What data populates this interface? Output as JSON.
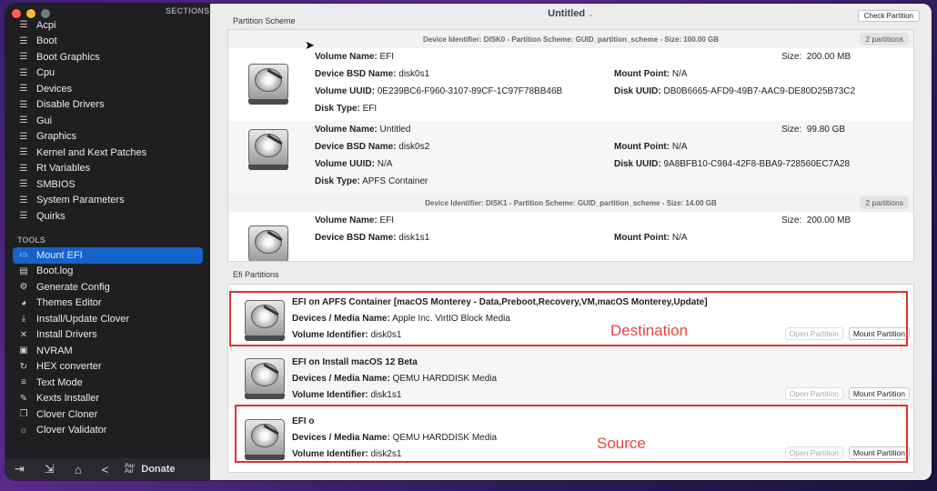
{
  "sidebar": {
    "sections_label": "SECTIONS",
    "sections": [
      {
        "label": "Acpi",
        "icon": "list-icon"
      },
      {
        "label": "Boot",
        "icon": "list-icon"
      },
      {
        "label": "Boot Graphics",
        "icon": "list-icon"
      },
      {
        "label": "Cpu",
        "icon": "list-icon"
      },
      {
        "label": "Devices",
        "icon": "list-icon"
      },
      {
        "label": "Disable Drivers",
        "icon": "list-icon"
      },
      {
        "label": "Gui",
        "icon": "list-icon"
      },
      {
        "label": "Graphics",
        "icon": "list-icon"
      },
      {
        "label": "Kernel and Kext Patches",
        "icon": "list-icon"
      },
      {
        "label": "Rt Variables",
        "icon": "list-icon"
      },
      {
        "label": "SMBIOS",
        "icon": "list-icon"
      },
      {
        "label": "System Parameters",
        "icon": "list-icon"
      },
      {
        "label": "Quirks",
        "icon": "list-icon"
      }
    ],
    "tools_label": "TOOLS",
    "tools": [
      {
        "label": "Mount EFI",
        "icon": "drive-icon",
        "active": true
      },
      {
        "label": "Boot.log",
        "icon": "log-icon"
      },
      {
        "label": "Generate Config",
        "icon": "gears-icon"
      },
      {
        "label": "Themes Editor",
        "icon": "palette-icon"
      },
      {
        "label": "Install/Update Clover",
        "icon": "download-icon"
      },
      {
        "label": "Install Drivers",
        "icon": "tools-icon"
      },
      {
        "label": "NVRAM",
        "icon": "chip-icon"
      },
      {
        "label": "HEX converter",
        "icon": "refresh-icon"
      },
      {
        "label": "Text Mode",
        "icon": "text-icon"
      },
      {
        "label": "Kexts Installer",
        "icon": "wrench-icon"
      },
      {
        "label": "Clover Cloner",
        "icon": "copy-icon"
      },
      {
        "label": "Clover Validator",
        "icon": "sun-icon"
      }
    ],
    "donate_pp": "Pay Pal",
    "donate_label": "Donate"
  },
  "window": {
    "title": "Untitled",
    "check_partition_label": "Check Partition",
    "partition_scheme_label": "Partition Scheme",
    "efi_partitions_label": "Efi Partitions"
  },
  "disks": [
    {
      "header": "Device Identifier: DISK0 - Partition Scheme: GUID_partition_scheme - Size: 100.00 GB",
      "count": "2 partitions",
      "partitions": [
        {
          "volume_name": "EFI",
          "size": "200.00 MB",
          "bsd_name": "disk0s1",
          "mount_point": "N/A",
          "volume_uuid": "0E239BC6-F960-3107-89CF-1C97F78BB46B",
          "disk_uuid": "DB0B6665-AFD9-49B7-AAC9-DE80D25B73C2",
          "disk_type": "EFI"
        },
        {
          "volume_name": "Untitled",
          "size": "99.80 GB",
          "bsd_name": "disk0s2",
          "mount_point": "N/A",
          "volume_uuid": "N/A",
          "disk_uuid": "9A8BFB10-C984-42F8-BBA9-728560EC7A28",
          "disk_type": "APFS Container"
        }
      ]
    },
    {
      "header": "Device Identifier: DISK1 - Partition Scheme: GUID_partition_scheme - Size: 14.00 GB",
      "count": "2 partitions",
      "partitions": [
        {
          "volume_name": "EFI",
          "size": "200.00 MB",
          "bsd_name": "disk1s1",
          "mount_point": "N/A"
        }
      ]
    }
  ],
  "labels": {
    "volume_name": "Volume Name:",
    "size": "Size:",
    "bsd_name": "Device BSD Name:",
    "mount_point": "Mount Point:",
    "volume_uuid": "Volume UUID:",
    "disk_uuid": "Disk UUID:",
    "disk_type": "Disk Type:",
    "media_name": "Devices / Media Name:",
    "volume_identifier": "Volume Identifier:",
    "open_partition": "Open Partition",
    "mount_partition": "Mount Partition"
  },
  "efi_partitions": [
    {
      "title": "EFI on APFS Container [macOS Monterey - Data,Preboot,Recovery,VM,macOS Monterey,Update]",
      "media": "Apple Inc. VirtIO Block Media",
      "identifier": "disk0s1"
    },
    {
      "title": "EFI on Install macOS 12 Beta",
      "media": "QEMU HARDDISK Media",
      "identifier": "disk1s1"
    },
    {
      "title": "EFI o",
      "media": "QEMU HARDDISK Media",
      "identifier": "disk2s1"
    }
  ],
  "annotations": {
    "destination": "Destination",
    "source": "Source",
    "color": "#e0312b"
  }
}
